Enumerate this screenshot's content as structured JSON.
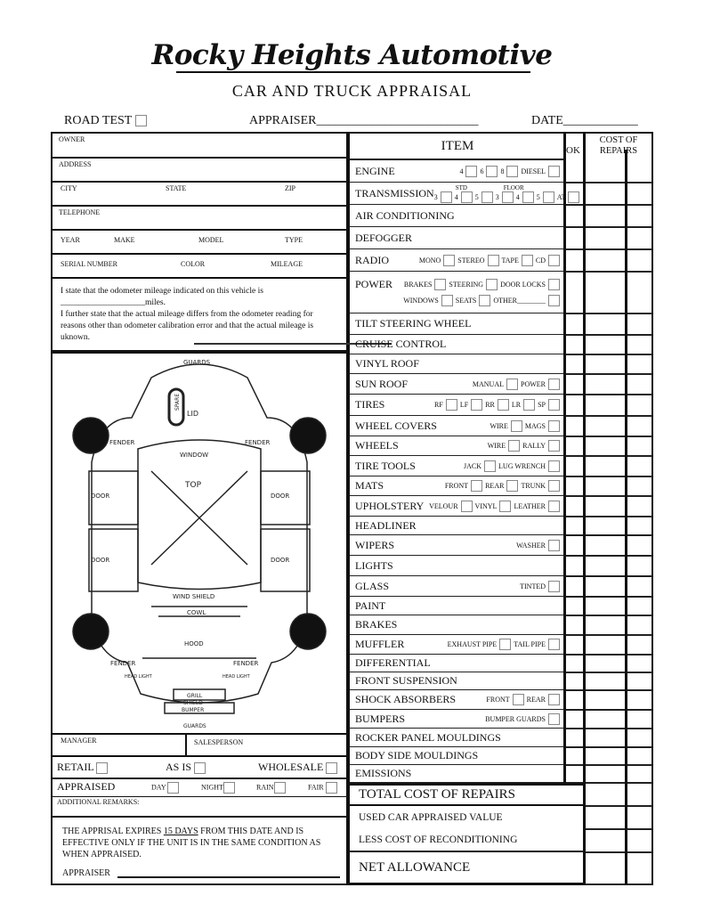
{
  "header": {
    "title": "Rocky Heights Automotive",
    "subtitle": "CAR AND TRUCK APPRAISAL",
    "road_test": "ROAD TEST",
    "appraiser": "APPRAISER__________________________",
    "date": "DATE____________"
  },
  "customer": {
    "owner": "OWNER",
    "address": "ADDRESS",
    "city": "CITY",
    "state": "STATE",
    "zip": "ZIP",
    "telephone": "TELEPHONE",
    "year": "YEAR",
    "make": "MAKE",
    "model": "MODEL",
    "type": "TYPE",
    "serial": "SERIAL NUMBER",
    "color": "COLOR",
    "mileage": "MILEAGE",
    "statement1": "I state that the odometer mileage indicated on this vehicle is",
    "statement2": "____________________miles.",
    "statement3": "I further state that the actual mileage differs from the odometer reading for reasons other than odometer calibration error and that the actual mileage is uknown."
  },
  "diagram": {
    "guards_top": "GUARDS",
    "spare": "SPARE",
    "lid": "LID",
    "fender": "FENDER",
    "window": "WINDOW",
    "top": "TOP",
    "door": "DOOR",
    "windshield": "WIND SHIELD",
    "cowl": "COWL",
    "hood": "HOOD",
    "headlight": "HEAD LIGHT",
    "grill": "GRILL",
    "shield": "SHIELD",
    "bumper": "BUMPER",
    "guards_bottom": "GUARDS"
  },
  "bottom_left": {
    "manager": "MANAGER",
    "salesperson": "SALESPERSON",
    "retail": "RETAIL",
    "as_is": "AS IS",
    "wholesale": "WHOLESALE",
    "appraised": "APPRAISED",
    "day": "DAY",
    "night": "NIGHT",
    "rain": "RAIN",
    "fair": "FAIR",
    "remarks": "ADDITIONAL REMARKS:",
    "expiry_a": "THE APPRISAL EXPIRES ",
    "expiry_days": "15 DAYS",
    "expiry_b": " FROM THIS DATE AND IS EFFECTIVE ONLY IF THE UNIT IS IN THE SAME CONDITION AS WHEN APPRAISED.",
    "appraiser": "APPRAISER"
  },
  "table": {
    "item_header": "ITEM",
    "ok_header": "OK",
    "cost_header": "COST OF REPAIRS",
    "rows": [
      {
        "label": "ENGINE",
        "options": [
          "4",
          "6",
          "8",
          "DIESEL"
        ]
      },
      {
        "label": "TRANSMISSION",
        "std": "STD",
        "floor": "FLOOR",
        "options": [
          "3",
          "4",
          "5",
          "3",
          "4",
          "5",
          "AT"
        ]
      },
      {
        "label": "AIR CONDITIONING",
        "options": []
      },
      {
        "label": "DEFOGGER",
        "options": []
      },
      {
        "label": "RADIO",
        "options": [
          "MONO",
          "STEREO",
          "TAPE",
          "CD"
        ]
      },
      {
        "label": "POWER",
        "options": [
          "BRAKES",
          "STEERING",
          "DOOR LOCKS"
        ],
        "options2": [
          "WINDOWS",
          "SEATS",
          "OTHER________"
        ]
      },
      {
        "label": "TILT STEERING WHEEL",
        "options": []
      },
      {
        "label": "CRUISE CONTROL",
        "options": []
      },
      {
        "label": "VINYL ROOF",
        "options": []
      },
      {
        "label": "SUN ROOF",
        "options": [
          "MANUAL",
          "POWER"
        ]
      },
      {
        "label": "TIRES",
        "options": [
          "RF",
          "LF",
          "RR",
          "LR",
          "SP"
        ]
      },
      {
        "label": "WHEEL COVERS",
        "options": [
          "WIRE",
          "MAGS"
        ]
      },
      {
        "label": "WHEELS",
        "options": [
          "WIRE",
          "RALLY"
        ]
      },
      {
        "label": "TIRE TOOLS",
        "options": [
          "JACK",
          "LUG WRENCH"
        ]
      },
      {
        "label": "MATS",
        "options": [
          "FRONT",
          "REAR",
          "TRUNK"
        ]
      },
      {
        "label": "UPHOLSTERY",
        "options": [
          "VELOUR",
          "VINYL",
          "LEATHER"
        ]
      },
      {
        "label": "HEADLINER",
        "options": []
      },
      {
        "label": "WIPERS",
        "options": [
          "WASHER"
        ]
      },
      {
        "label": "LIGHTS",
        "options": []
      },
      {
        "label": "GLASS",
        "options": [
          "TINTED"
        ]
      },
      {
        "label": "PAINT",
        "options": []
      },
      {
        "label": "BRAKES",
        "options": []
      },
      {
        "label": "MUFFLER",
        "options": [
          "EXHAUST PIPE",
          "TAIL PIPE"
        ]
      },
      {
        "label": "DIFFERENTIAL",
        "options": []
      },
      {
        "label": "FRONT SUSPENSION",
        "options": []
      },
      {
        "label": "SHOCK ABSORBERS",
        "options": [
          "FRONT",
          "REAR"
        ]
      },
      {
        "label": "BUMPERS",
        "options": [
          "BUMPER GUARDS"
        ]
      },
      {
        "label": "ROCKER PANEL MOULDINGS",
        "options": []
      },
      {
        "label": "BODY SIDE MOULDINGS",
        "options": []
      },
      {
        "label": "EMISSIONS",
        "options": []
      }
    ],
    "total": "TOTAL COST OF REPAIRS",
    "used_value": "USED CAR APPRAISED VALUE",
    "less_cost": "LESS COST OF RECONDITIONING",
    "net": "NET ALLOWANCE"
  }
}
